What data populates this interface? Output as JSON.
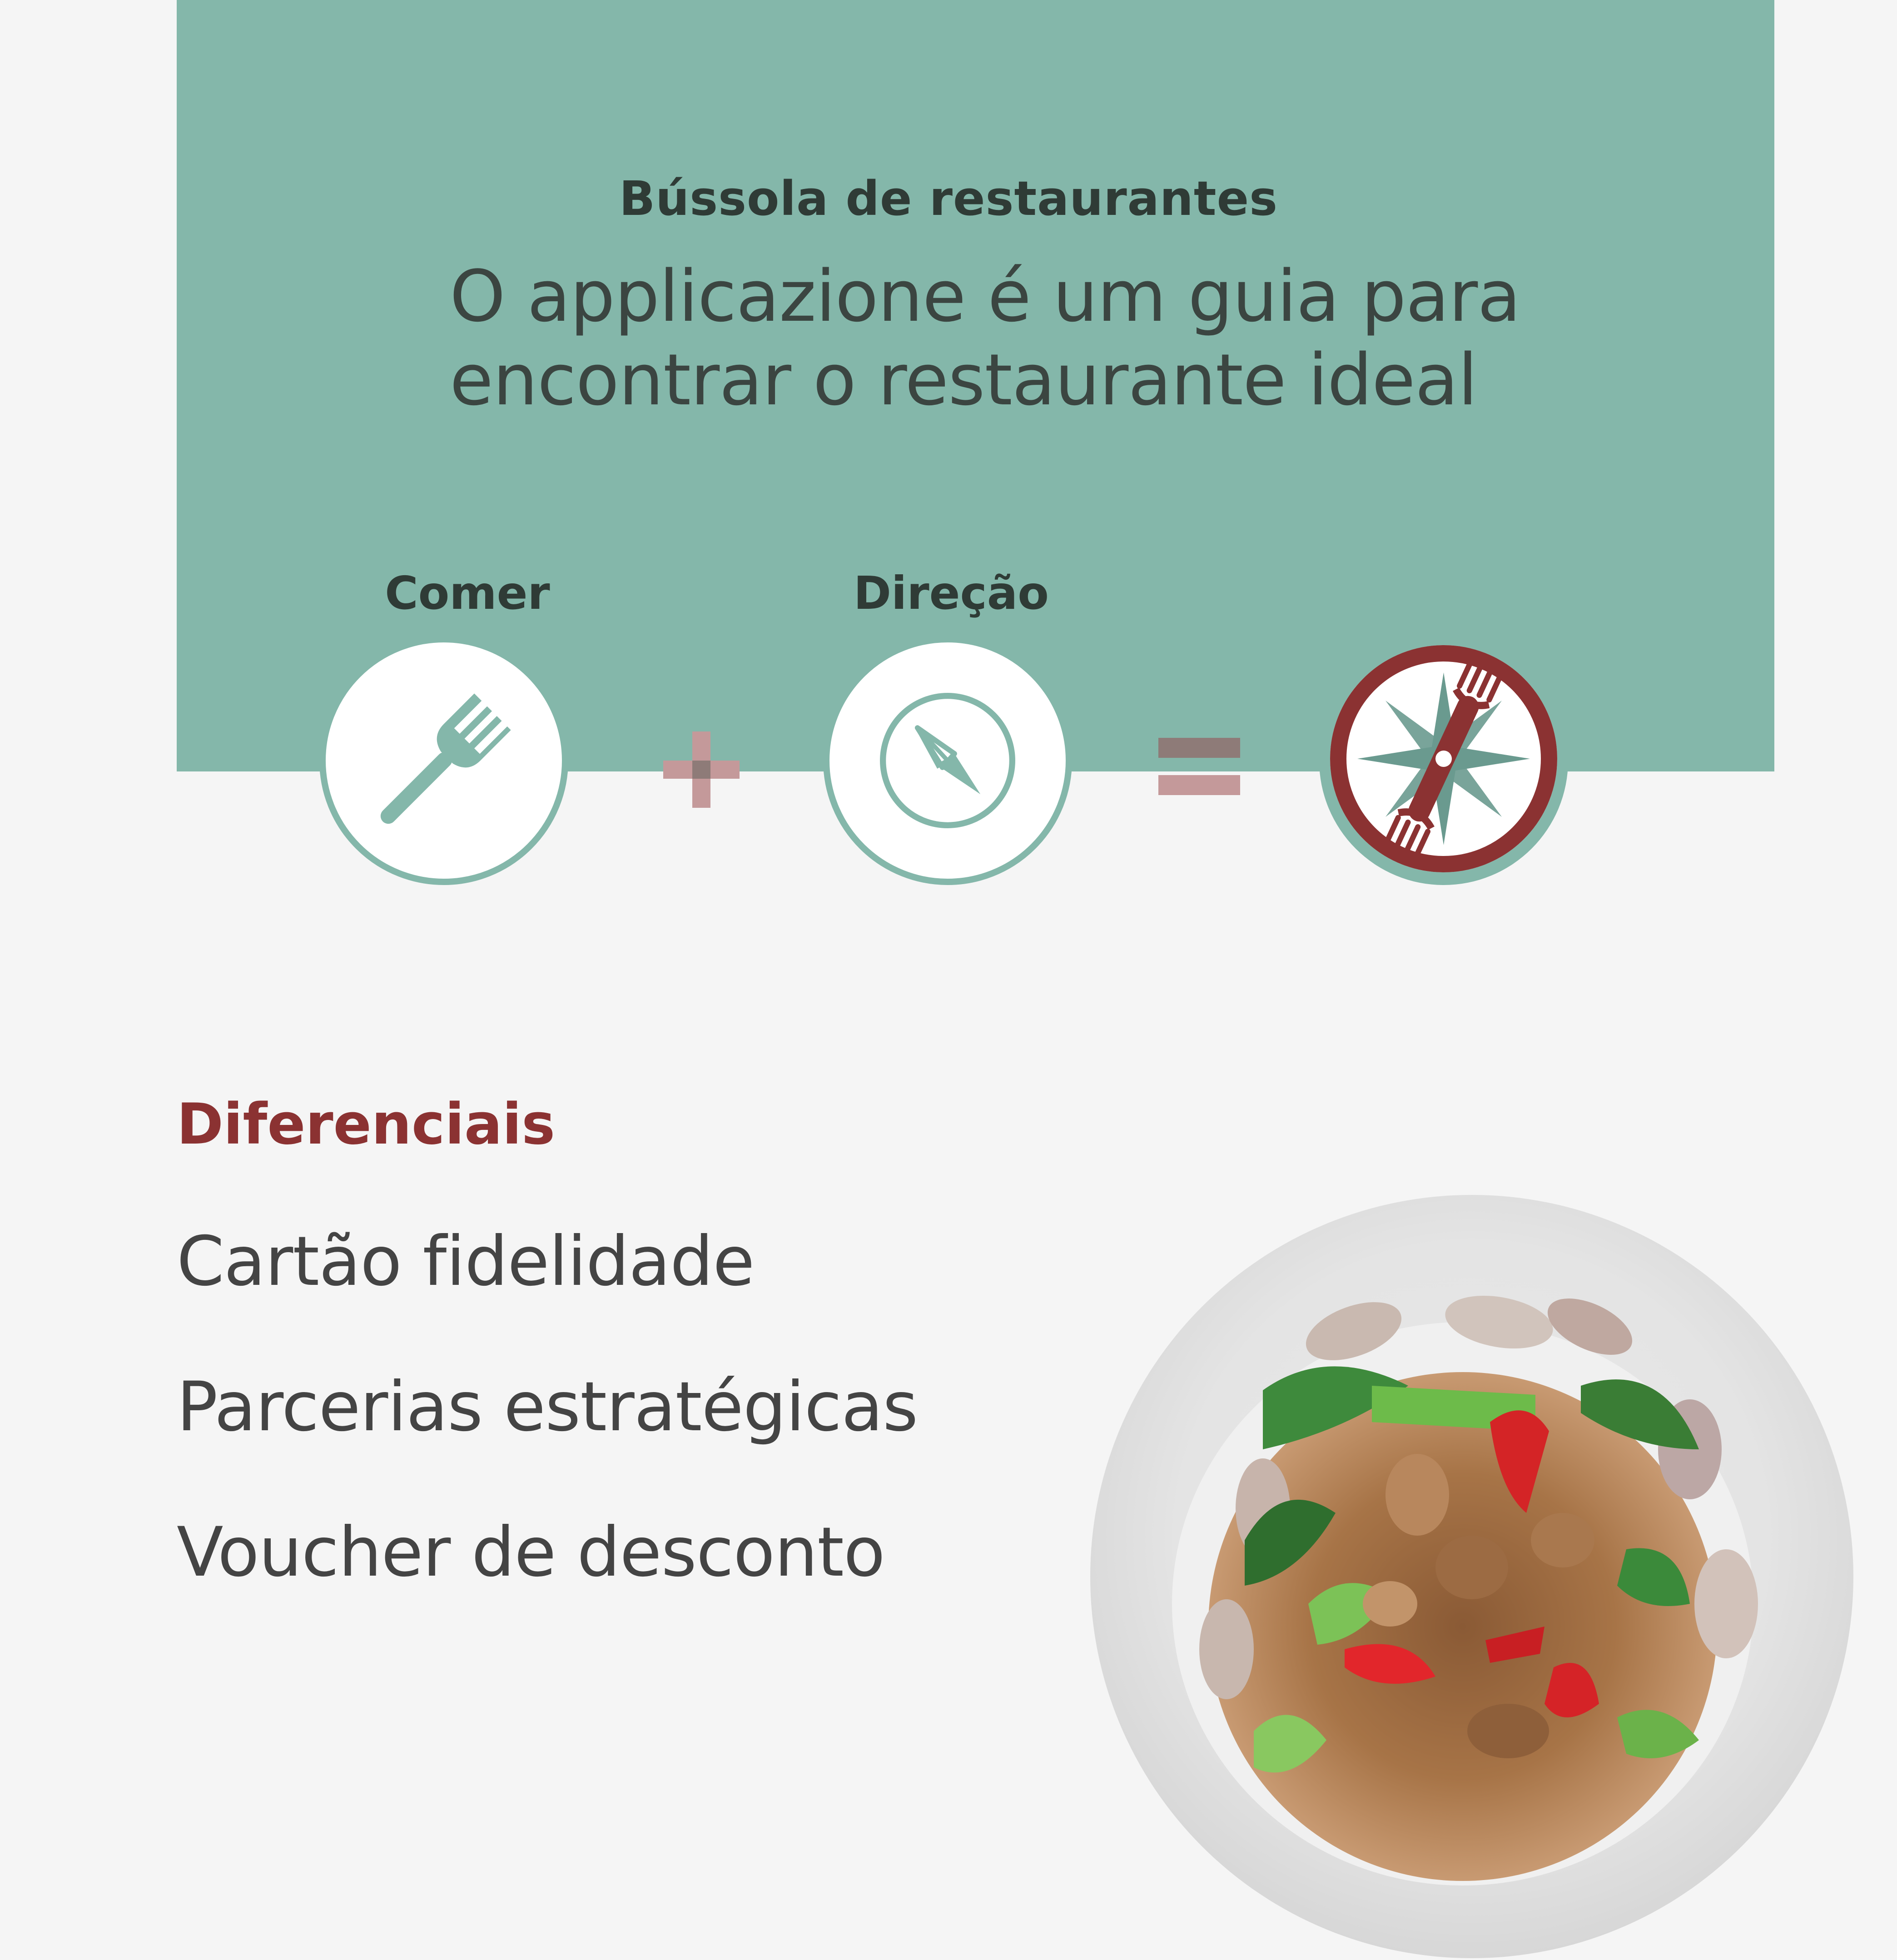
{
  "header": {
    "app_name": "Bússola de restaurantes",
    "tagline_line1": "O applicazione é um guia para",
    "tagline_line2": "encontrar o restaurante ideal"
  },
  "concept": {
    "steps": [
      {
        "label": "Comer",
        "icon": "fork-icon"
      },
      {
        "label": "Direção",
        "icon": "compass-icon"
      }
    ],
    "operators": [
      "plus-icon",
      "equals-icon"
    ],
    "result_icon": "fork-compass-logo-icon"
  },
  "differentials": {
    "heading": "Diferenciais",
    "items": [
      "Cartão fidelidade",
      "Parcerias estratégicas",
      "Voucher de desconto"
    ]
  },
  "colors": {
    "teal": "#84b7aa",
    "dark_red": "#8b3232",
    "muted_red": "#c4999a",
    "text_dark": "#2f3b36"
  }
}
